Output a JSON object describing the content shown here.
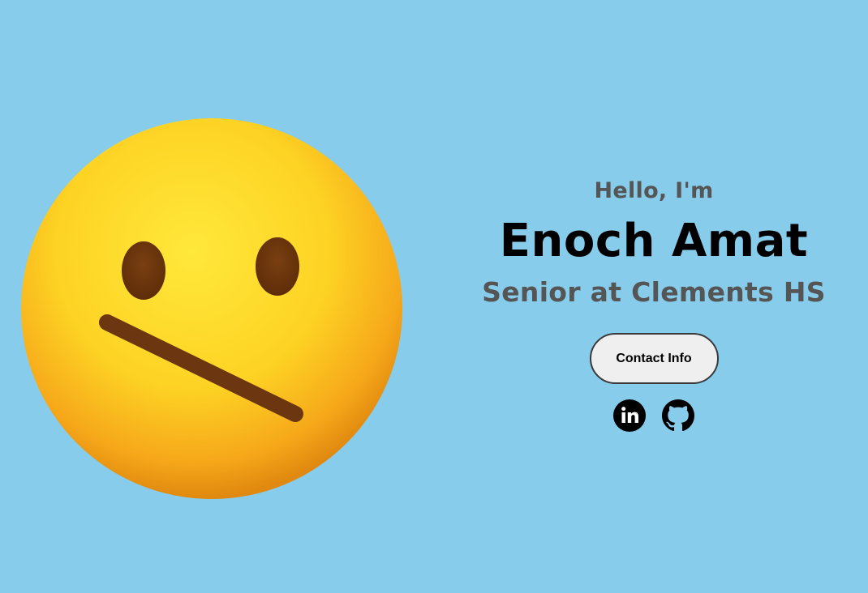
{
  "profile": {
    "image": "neutral-face-emoji"
  },
  "hero": {
    "greeting": "Hello, I'm",
    "name": "Enoch Amat",
    "subtitle": "Senior at Clements HS"
  },
  "buttons": {
    "contact_label": "Contact Info"
  },
  "socials": [
    {
      "icon": "linkedin-icon"
    },
    {
      "icon": "github-icon"
    }
  ],
  "colors": {
    "background": "#87cceb",
    "greeting": "#555555",
    "name": "#000000",
    "subtitle": "#555555",
    "button_bg": "#efefef",
    "button_border": "#3a3a3a"
  }
}
